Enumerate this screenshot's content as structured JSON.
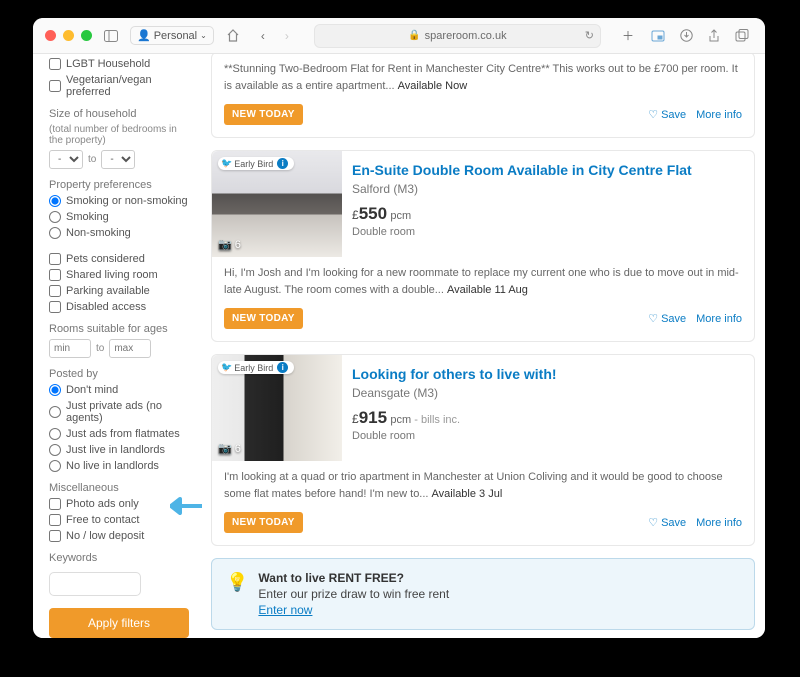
{
  "browser": {
    "personal_label": "Personal",
    "url": "spareroom.co.uk"
  },
  "sidebar": {
    "chk_lgbt": "LGBT Household",
    "chk_veg": "Vegetarian/vegan preferred",
    "h_size": "Size of household",
    "size_sub": "(total number of bedrooms in the property)",
    "to": "to",
    "sel_dash": "-",
    "h_prefs": "Property preferences",
    "r_smoke_any": "Smoking or non-smoking",
    "r_smoke": "Smoking",
    "r_nonsmoke": "Non-smoking",
    "chk_pets": "Pets considered",
    "chk_shared": "Shared living room",
    "chk_parking": "Parking available",
    "chk_disabled": "Disabled access",
    "h_ages": "Rooms suitable for ages",
    "ph_min": "min",
    "ph_max": "max",
    "h_posted": "Posted by",
    "r_dontmind": "Don't mind",
    "r_private": "Just private ads (no agents)",
    "r_flatmates": "Just ads from flatmates",
    "r_livein": "Just live in landlords",
    "r_nolivein": "No live in landlords",
    "h_misc": "Miscellaneous",
    "chk_photo": "Photo ads only",
    "chk_free": "Free to contact",
    "chk_deposit": "No / low deposit",
    "h_keywords": "Keywords",
    "apply": "Apply filters"
  },
  "listings": [
    {
      "snippet": "**Stunning Two-Bedroom Flat for Rent in Manchester City Centre** This works out to be £700 per room. It is available as a entire apartment...",
      "avail": "Available Now"
    },
    {
      "early": "Early Bird",
      "photo_count": "6",
      "title": "En-Suite Double Room Available in City Centre Flat",
      "loc": "Salford (M3)",
      "price": "550",
      "price_prefix": "£",
      "pcm": "pcm",
      "roomtype": "Double room",
      "snippet": "Hi, I'm Josh and I'm looking for a new roommate to replace my current one who is due to move out in mid-late August. The room comes with a double...",
      "avail": "Available 11 Aug"
    },
    {
      "early": "Early Bird",
      "photo_count": "6",
      "title": "Looking for others to live with!",
      "loc": "Deansgate (M3)",
      "price": "915",
      "price_prefix": "£",
      "pcm": "pcm",
      "bills": " - bills inc.",
      "roomtype": "Double room",
      "snippet": "I'm looking at a quad or trio apartment in Manchester at Union Coliving and it would be good to choose some flat mates before hand! I'm new to...",
      "avail": "Available 3 Jul"
    }
  ],
  "labels": {
    "newtoday": "NEW TODAY",
    "save": "Save",
    "more": "More info"
  },
  "promo": {
    "title": "Want to live RENT FREE?",
    "body": "Enter our prize draw to win free rent",
    "link": "Enter now"
  }
}
